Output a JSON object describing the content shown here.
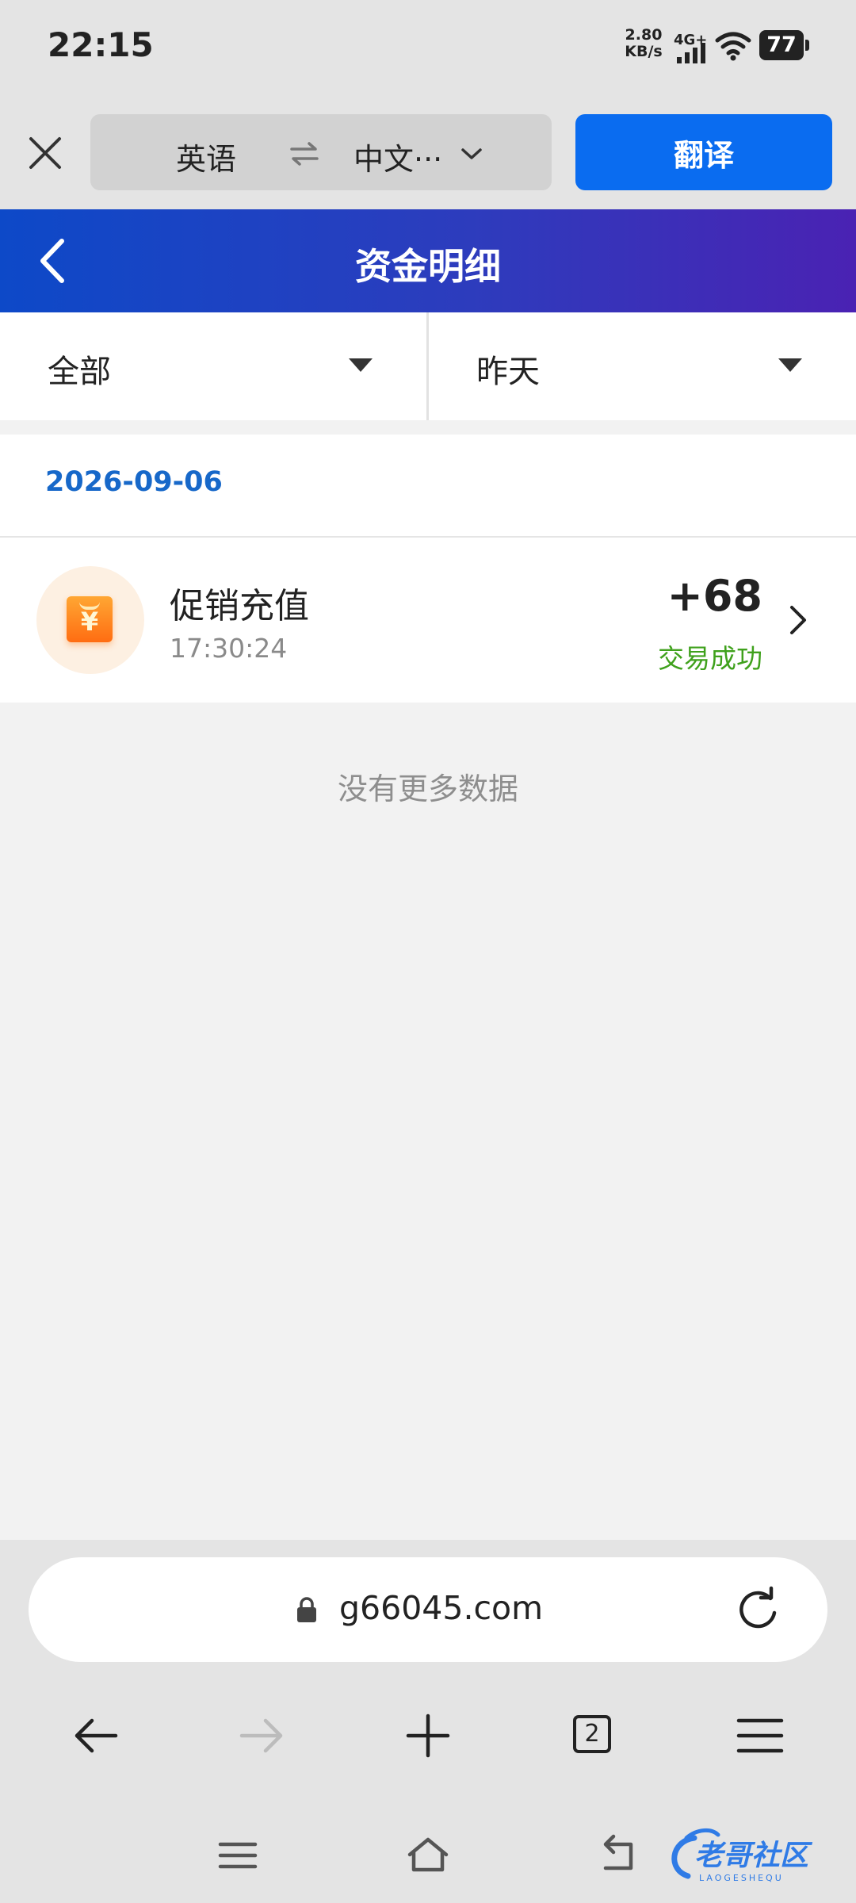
{
  "status_bar": {
    "time": "22:15",
    "net_speed_value": "2.80",
    "net_speed_unit": "KB/s",
    "network_type": "4G+",
    "battery_level": "77"
  },
  "translate_bar": {
    "source_language": "英语",
    "target_language": "中文···",
    "translate_button_label": "翻译"
  },
  "header": {
    "title": "资金明细"
  },
  "filters": {
    "type_label": "全部",
    "date_label": "昨天"
  },
  "list": {
    "date": "2026-09-06",
    "transactions": [
      {
        "title": "促销充值",
        "time": "17:30:24",
        "amount": "+68",
        "status": "交易成功",
        "icon": "red-envelope-yen-icon"
      }
    ],
    "end_text": "没有更多数据"
  },
  "browser": {
    "url": "g66045.com",
    "tab_count": "2"
  },
  "watermark": {
    "text": "老哥社区",
    "subtext": "LAOGESHEQU"
  },
  "colors": {
    "accent_blue": "#0a6cf0",
    "header_gradient_start": "#0d49c8",
    "header_gradient_end": "#4a22b3",
    "date_blue": "#1768c9",
    "success_green": "#3fa11c",
    "icon_orange": "#ff8a1f"
  }
}
